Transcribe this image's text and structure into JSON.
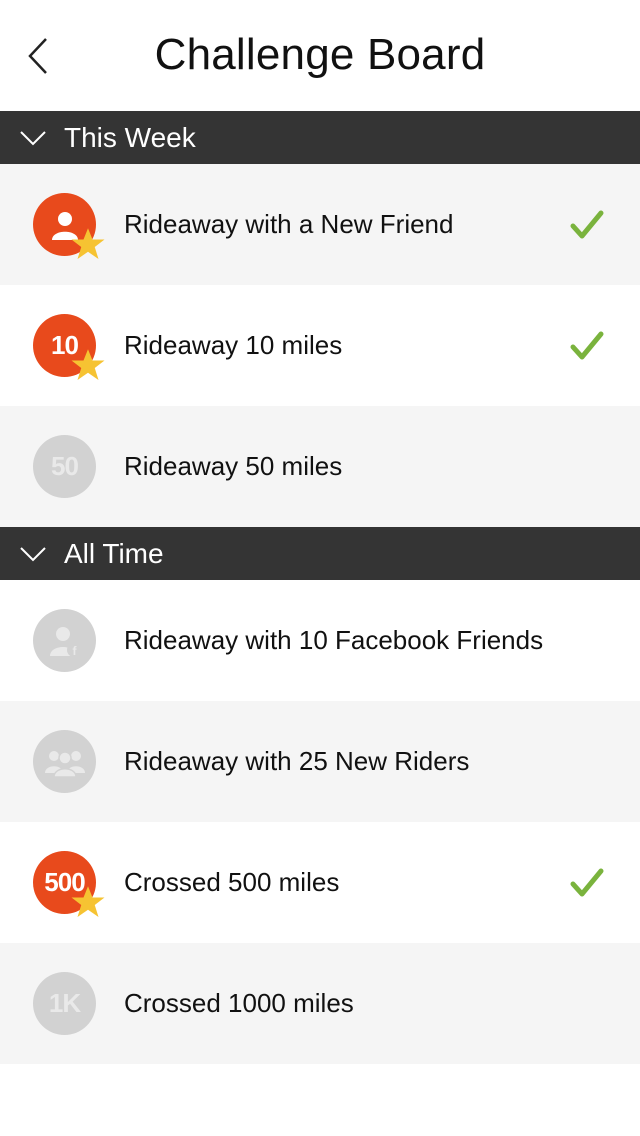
{
  "header": {
    "title": "Challenge Board"
  },
  "sections": [
    {
      "label": "This Week",
      "items": [
        {
          "label": "Rideaway with a New Friend",
          "badge": "",
          "icon": "user-icon",
          "completed": true
        },
        {
          "label": "Rideaway 10 miles",
          "badge": "10",
          "completed": true
        },
        {
          "label": "Rideaway 50 miles",
          "badge": "50",
          "completed": false
        }
      ]
    },
    {
      "label": "All Time",
      "items": [
        {
          "label": "Rideaway with 10 Facebook Friends",
          "badge": "",
          "icon": "facebook-user-icon",
          "completed": false
        },
        {
          "label": "Rideaway with 25 New Riders",
          "badge": "",
          "icon": "group-icon",
          "completed": false
        },
        {
          "label": "Crossed 500 miles",
          "badge": "500",
          "completed": true
        },
        {
          "label": "Crossed 1000 miles",
          "badge": "1K",
          "completed": false
        }
      ]
    }
  ],
  "colors": {
    "accent": "#e84a1c",
    "star": "#f6c332",
    "check": "#7ab33d",
    "section_bg": "#343434",
    "inactive_badge": "#d2d2d2"
  }
}
